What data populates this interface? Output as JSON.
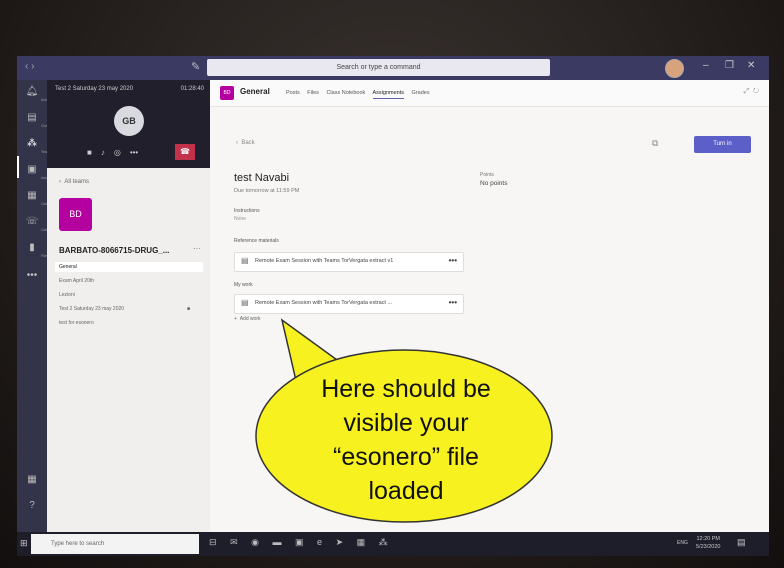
{
  "titlebar": {
    "search_placeholder": "Search or type a command"
  },
  "rail": {
    "items": [
      {
        "icon": "bell-icon",
        "label": "Activity"
      },
      {
        "icon": "chat-icon",
        "label": "Chat"
      },
      {
        "icon": "teams-icon",
        "label": "Teams"
      },
      {
        "icon": "assignments-icon",
        "label": "Assignments"
      },
      {
        "icon": "calendar-icon",
        "label": "Calendar"
      },
      {
        "icon": "calls-icon",
        "label": "Calls"
      },
      {
        "icon": "files-icon",
        "label": "Files"
      }
    ]
  },
  "call": {
    "title": "Test 2 Saturday 23 may 2020",
    "time": "01:28:40",
    "avatar_initials": "GB"
  },
  "team": {
    "back_label": "All teams",
    "avatar_initials": "BD",
    "name": "BARBATO-8066715-DRUG_...",
    "channels": [
      "General",
      "Exam April 20th",
      "Lezioni",
      "Test 2 Saturday 23 may 2020",
      "test for esonero"
    ]
  },
  "header": {
    "channel_icon": "BD",
    "channel": "General",
    "tabs": [
      "Posts",
      "Files",
      "Class Notebook",
      "Assignments",
      "Grades"
    ],
    "active_tab": "Assignments"
  },
  "assignment": {
    "back_label": "Back",
    "turn_in_label": "Turn in",
    "title": "test Navabi",
    "due": "Due tomorrow at 11:59 PM",
    "points_label": "Points",
    "points_value": "No points",
    "instructions_label": "Instructions",
    "instructions_value": "None",
    "reference_label": "Reference materials",
    "reference_file": "Remote Exam Session with Teams TorVergata   extract   v1",
    "my_work_label": "My work",
    "my_work_file": "Remote Exam Session with Teams TorVergata   extract ...",
    "add_work_label": "Add work"
  },
  "taskbar": {
    "search_placeholder": "Type here to search",
    "lang": "ENG",
    "time": "12:20 PM",
    "date": "5/23/2020"
  },
  "callout": {
    "lines": [
      "Here should be",
      "visible your",
      "“esonero” file",
      "loaded"
    ],
    "fill": "#f7f21f"
  }
}
